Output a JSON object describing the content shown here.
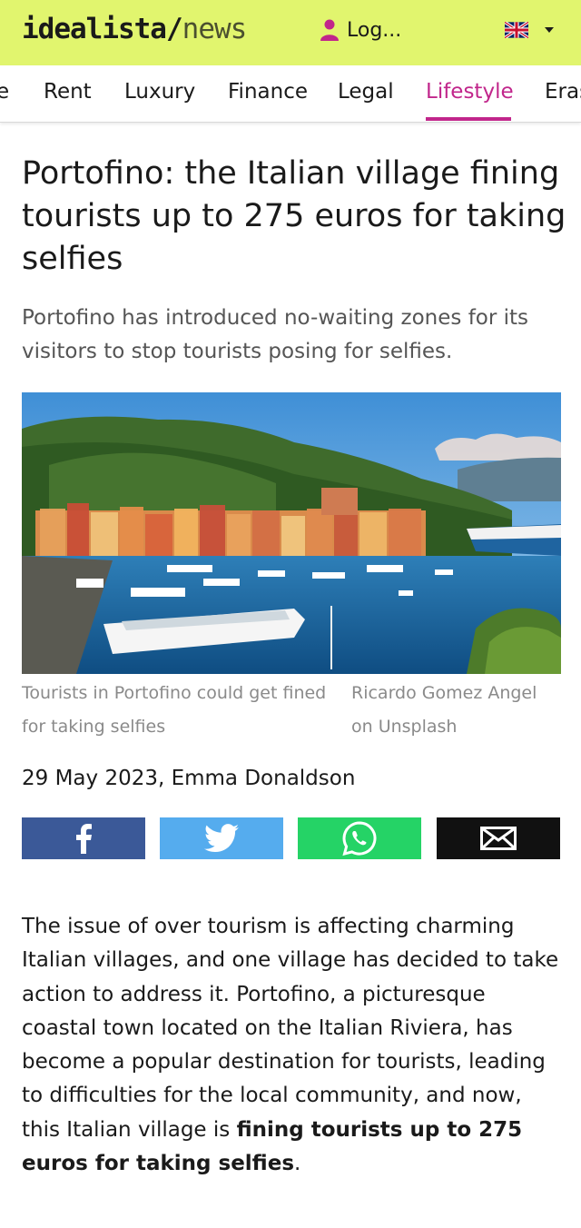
{
  "header": {
    "logo_main": "idealista",
    "logo_sep": "/",
    "logo_news": "news",
    "login_label": "Log...",
    "bg_color": "#e1f56e"
  },
  "nav": {
    "items": [
      {
        "label": "e"
      },
      {
        "label": "Rent"
      },
      {
        "label": "Luxury"
      },
      {
        "label": "Finance"
      },
      {
        "label": "Legal"
      },
      {
        "label": "Lifestyle",
        "active": true
      },
      {
        "label": "Eras"
      }
    ],
    "accent_color": "#c1268b"
  },
  "article": {
    "title": "Portofino: the Italian village fining tourists up to 275 euros for taking selfies",
    "lead": "Portofino has introduced no-waiting zones for its visitors to stop tourists posing for selfies.",
    "image_caption": "Tourists in Portofino could get fined for taking selfies",
    "image_credit": "Ricardo Gomez Angel on Unsplash",
    "byline": "29 May 2023, Emma Donaldson",
    "body_start": "The issue of over tourism is affecting charming Italian villages, and one village has decided to take action to address it. Portofino, a picturesque coastal town located on the Italian Riviera, has become a popular destination for tourists, leading to difficulties for the local community, and now, this Italian village is ",
    "body_bold": "fining tourists up to 275 euros for taking selfies",
    "body_end": "."
  },
  "share": {
    "buttons": [
      {
        "icon": "facebook-icon",
        "color": "#3b5998"
      },
      {
        "icon": "twitter-icon",
        "color": "#55acee"
      },
      {
        "icon": "whatsapp-icon",
        "color": "#25d366"
      },
      {
        "icon": "mail-icon",
        "color": "#111111"
      }
    ]
  }
}
